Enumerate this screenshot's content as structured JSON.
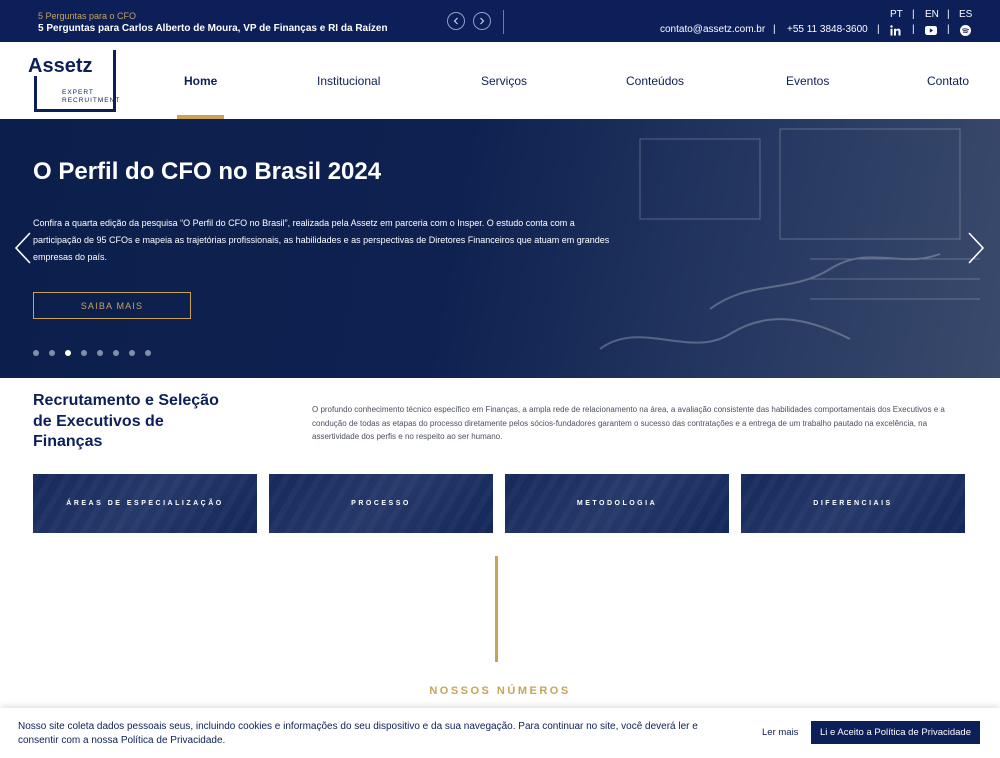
{
  "topbar": {
    "news_kicker": "5 Perguntas para o CFO",
    "news_headline": "5 Perguntas para Carlos Alberto de Moura, VP de Finanças e RI da Raízen",
    "languages": [
      "PT",
      "EN",
      "ES"
    ],
    "email": "contato@assetz.com.br",
    "phone": "+55 11 3848-3600",
    "separator": "|"
  },
  "logo": {
    "name": "Assetz",
    "line1": "EXPERT",
    "line2": "RECRUITMENT"
  },
  "nav": {
    "items": [
      "Home",
      "Institucional",
      "Serviços",
      "Conteúdos",
      "Eventos",
      "Contato"
    ],
    "active": "Home"
  },
  "hero": {
    "title": "O Perfil do CFO no Brasil 2024",
    "text": "Confira a quarta edição da pesquisa “O Perfil do CFO no Brasil”, realizada pela Assetz em parceria com o Insper. O estudo conta com a participação de 95 CFOs e mapeia as trajetórias profissionais, as habilidades e as perspectivas de Diretores Financeiros que atuam em grandes empresas do país.",
    "button": "SAIBA MAIS",
    "slide_count": 8,
    "active_slide": 3
  },
  "intro": {
    "title": "Recrutamento e Seleção de Executivos de Finanças",
    "text": "O profundo conhecimento técnico específico em Finanças, a ampla rede de relacionamento na área, a avaliação consistente das habilidades comportamentais dos Executivos e a condução de todas as etapas do processo diretamente pelos sócios-fundadores garantem o sucesso das contratações e a entrega de um trabalho pautado na excelência, na assertividade dos perfis e no respeito ao ser humano."
  },
  "cards": [
    "ÁREAS DE ESPECIALIZAÇÃO",
    "PROCESSO",
    "METODOLOGIA",
    "DIFERENCIAIS"
  ],
  "numbers": {
    "label": "NOSSOS NÚMEROS"
  },
  "cookie": {
    "text": "Nosso site coleta dados pessoais seus, incluindo cookies e informações do seu dispositivo e da sua navegação. Para continuar no site, você deverá ler e consentir com a nossa Política de Privacidade.",
    "read_more": "Ler mais",
    "accept": "Li e Aceito a Política de Privacidade"
  },
  "colors": {
    "navy": "#0c1f58",
    "gold": "#c9a35a"
  },
  "icons": [
    "chevron-left-icon",
    "chevron-right-icon",
    "linkedin-icon",
    "youtube-icon",
    "spotify-icon"
  ]
}
